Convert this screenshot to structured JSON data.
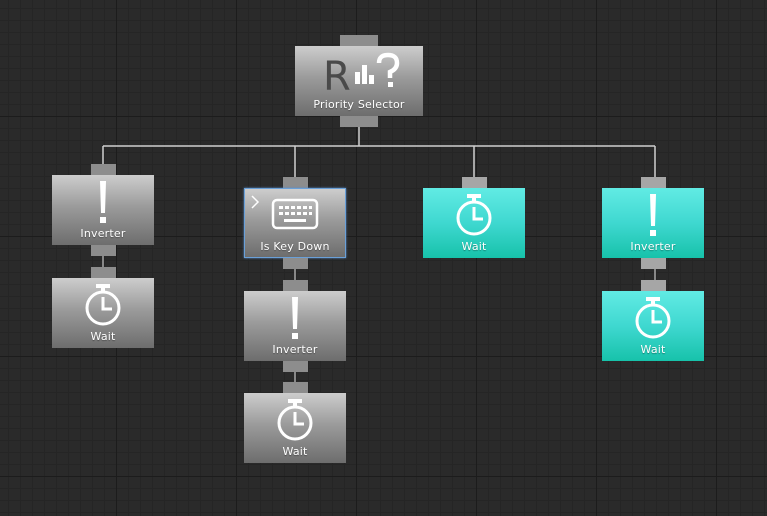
{
  "root": {
    "label": "Priority Selector",
    "icon": "priority-selector-icon",
    "icon_text": "R"
  },
  "branches": [
    {
      "task": {
        "label": "Inverter",
        "icon": "exclamation-icon"
      },
      "child": {
        "label": "Wait",
        "icon": "stopwatch-icon"
      }
    },
    {
      "task": {
        "label": "Is Key Down",
        "icon": "keyboard-icon",
        "selected": true
      },
      "child": {
        "label": "Inverter",
        "icon": "exclamation-icon"
      },
      "grandchild": {
        "label": "Wait",
        "icon": "stopwatch-icon"
      }
    },
    {
      "task": {
        "label": "Wait",
        "icon": "stopwatch-icon",
        "state": "running"
      }
    },
    {
      "task": {
        "label": "Inverter",
        "icon": "exclamation-icon",
        "state": "running"
      },
      "child": {
        "label": "Wait",
        "icon": "stopwatch-icon",
        "state": "running"
      }
    }
  ],
  "colors": {
    "background": "#2a2a2a",
    "node_gray_top": "#cdcdcd",
    "node_gray_bottom": "#6d6d6d",
    "node_running_top": "#61ebe4",
    "node_running_bottom": "#17c2aa",
    "connector": "#d0d0d0",
    "selection_border": "#6aa0d8"
  }
}
